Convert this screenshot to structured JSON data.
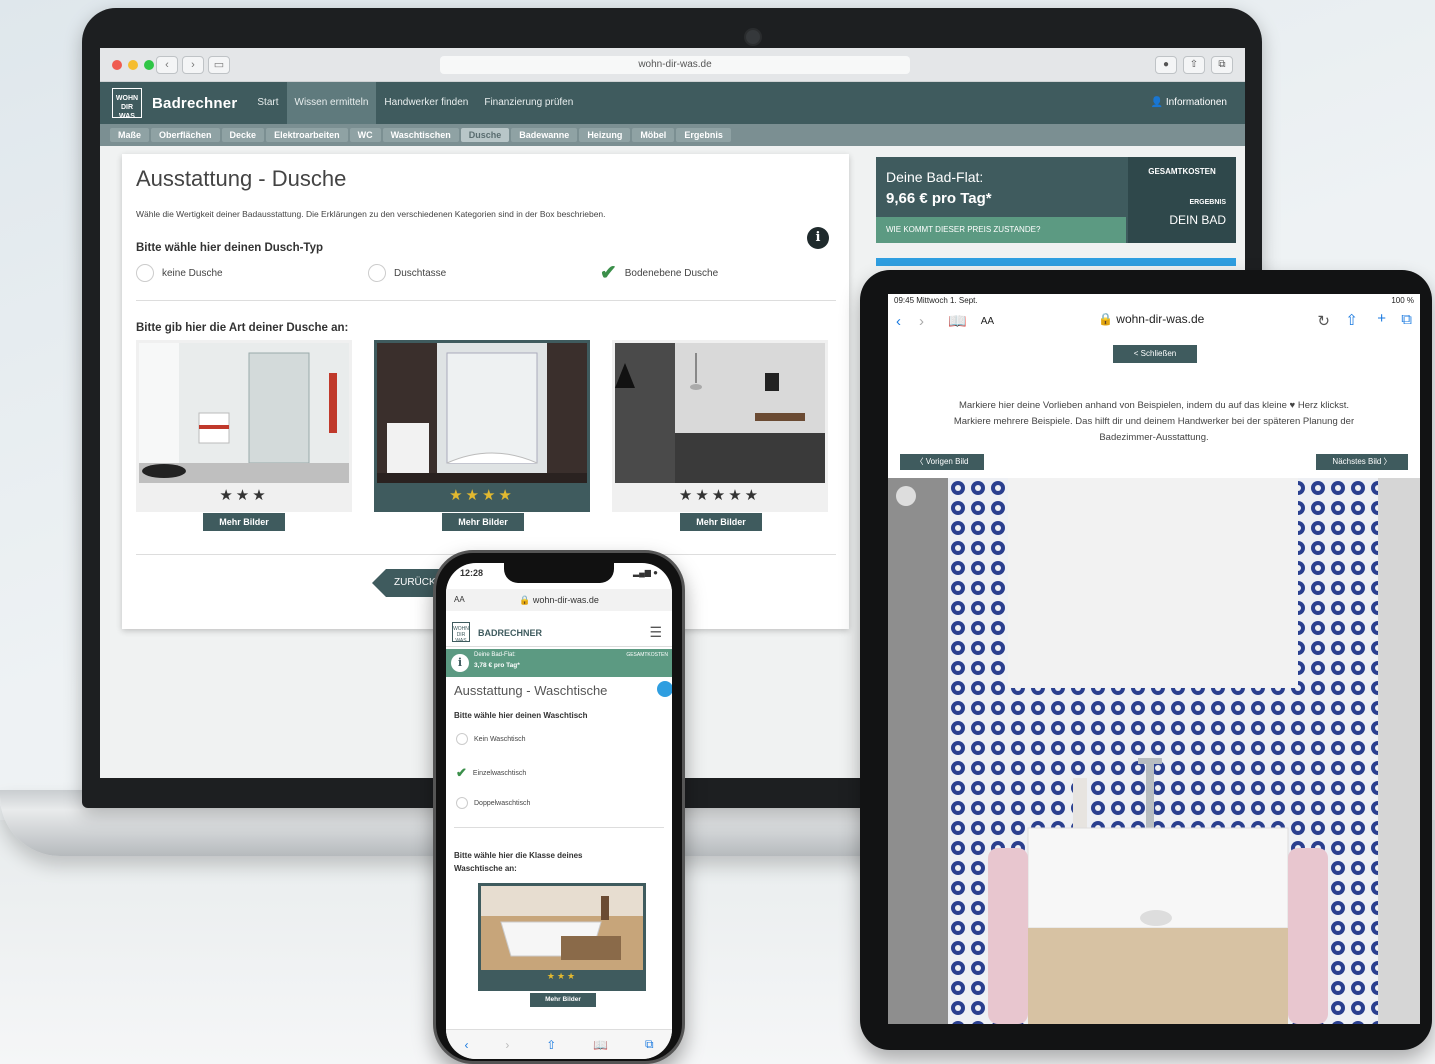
{
  "laptop": {
    "browser": {
      "url": "wohn-dir-was.de"
    },
    "nav": {
      "logo_text": "WOHN DIR WAS",
      "brand": "Badrechner",
      "menu": [
        "Start",
        "Wissen ermitteln",
        "Handwerker finden",
        "Finanzierung prüfen"
      ],
      "user": "Informationen"
    },
    "crumbs": [
      "Maße",
      "Oberflächen",
      "Decke",
      "Elektroarbeiten",
      "WC",
      "Waschtischen",
      "Dusche",
      "Badewanne",
      "Heizung",
      "Möbel",
      "Ergebnis"
    ],
    "card": {
      "title": "Ausstattung - Dusche",
      "intro": "Wähle die Wertigkeit deiner Badausstattung. Die Erklärungen zu den verschiedenen Kategorien sind in der  Box beschrieben.",
      "q1": "Bitte wähle hier deinen Dusch-Typ",
      "options": [
        "keine Dusche",
        "Duschtasse",
        "Bodenebene Dusche"
      ],
      "q2": "Bitte gib hier die Art deiner Dusche an:",
      "tiles": [
        {
          "stars": "★★★",
          "more": "Mehr Bilder"
        },
        {
          "stars": "★★★★",
          "more": "Mehr Bilder"
        },
        {
          "stars": "★★★★★",
          "more": "Mehr Bilder"
        }
      ],
      "back": "ZURÜCK"
    },
    "flat": {
      "label": "Deine Bad-Flat:",
      "price": "9,66 € pro Tag*",
      "link": "WIE KOMMT DIESER PREIS ZUSTANDE?",
      "total": "GESAMTKOSTEN",
      "result": "ERGEBNIS",
      "yourbath": "DEIN BAD"
    }
  },
  "tablet": {
    "status_time": "09:45  Mittwoch 1. Sept.",
    "status_right": "100 %",
    "url": "wohn-dir-was.de",
    "aa": "AA",
    "close": "< Schließen",
    "text1": "Markiere hier deine Vorlieben anhand von Beispielen, indem du auf das kleine ♥ Herz klickst.",
    "text2": "Markiere mehrere Beispiele. Das hilft dir und deinem Handwerker bei der späteren Planung der",
    "text3": "Badezimmer-Ausstattung.",
    "prev": "〈 Vorigen Bild",
    "next": "Nächstes Bild 〉"
  },
  "phone": {
    "time": "12:28",
    "url": "wohn-dir-was.de",
    "aa": "AA",
    "brand": "BADRECHNER",
    "logo_text": "WOHN DIR WAS",
    "green_l1": "Deine Bad-Flat:",
    "green_l2": "3,78 € pro Tag*",
    "green_r": "GESAMTKOSTEN",
    "title": "Ausstattung - Waschtische",
    "q1": "Bitte wähle hier deinen Waschtisch",
    "options": [
      "Kein Waschtisch",
      "Einzelwaschtisch",
      "Doppelwaschtisch"
    ],
    "q2": "Bitte wähle hier die Klasse deines Waschtische an:",
    "stars": "★★★",
    "more": "Mehr Bilder"
  },
  "colors": {
    "primary": "#3f5b5e",
    "accent": "#5c9a82",
    "blue": "#2f9ee0",
    "star": "#e2b930"
  }
}
